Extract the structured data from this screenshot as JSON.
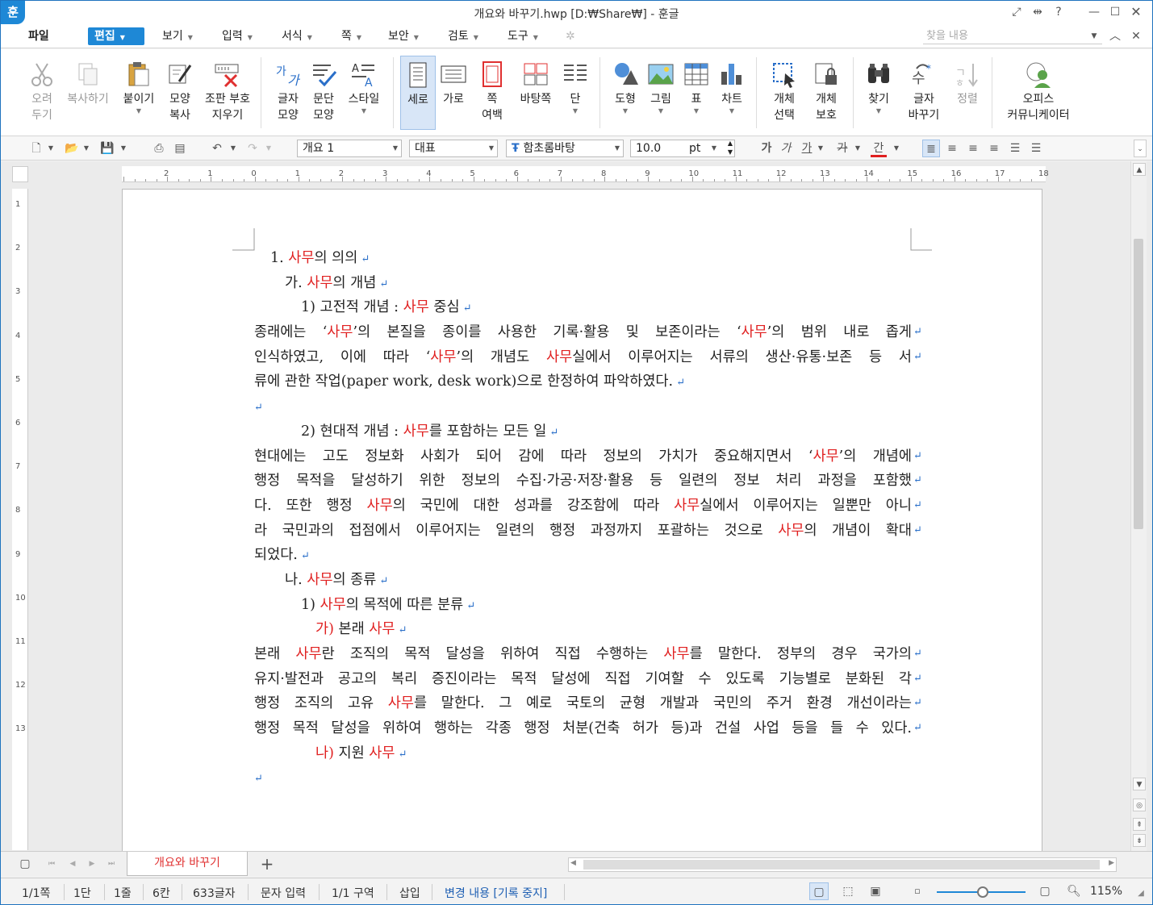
{
  "window": {
    "title": "개요와 바꾸기.hwp [D:₩Share₩] - 훈글",
    "logo": "훈"
  },
  "menus": [
    {
      "label": "파일"
    },
    {
      "label": "편집"
    },
    {
      "label": "보기"
    },
    {
      "label": "입력"
    },
    {
      "label": "서식"
    },
    {
      "label": "쪽"
    },
    {
      "label": "보안"
    },
    {
      "label": "검토"
    },
    {
      "label": "도구"
    }
  ],
  "find": {
    "placeholder": "찾을 내용"
  },
  "ribbon": {
    "cut": [
      "오려",
      "두기"
    ],
    "copy": "복사하기",
    "paste": "붙이기",
    "format_copy": [
      "모양",
      "복사"
    ],
    "clear_marks": [
      "조판 부호",
      "지우기"
    ],
    "char_shape": [
      "글자",
      "모양"
    ],
    "para_shape": [
      "문단",
      "모양"
    ],
    "style": "스타일",
    "vertical": "세로",
    "horizontal": "가로",
    "page_margin": [
      "쪽",
      "여백"
    ],
    "master_page": "바탕쪽",
    "columns": "단",
    "shape": "도형",
    "picture": "그림",
    "table": "표",
    "chart": "차트",
    "obj_select": [
      "개체",
      "선택"
    ],
    "obj_protect": [
      "개체",
      "보호"
    ],
    "find": "찾기",
    "replace": [
      "글자",
      "바꾸기"
    ],
    "sort": "정렬",
    "office": [
      "오피스",
      "커뮤니케이터"
    ]
  },
  "format": {
    "style": "개요 1",
    "lang": "대표",
    "font": "함초롬바탕",
    "size": "10.0",
    "unit": "pt"
  },
  "document": {
    "lines": [
      {
        "indent": 20,
        "parts": [
          [
            "1. ",
            0
          ],
          [
            "사무",
            1
          ],
          [
            "의 의의",
            0
          ]
        ]
      },
      {
        "indent": 38,
        "parts": [
          [
            "가. ",
            0
          ],
          [
            "사무",
            1
          ],
          [
            "의 개념",
            0
          ]
        ]
      },
      {
        "indent": 58,
        "parts": [
          [
            "1) 고전적 개념 : ",
            0
          ],
          [
            "사무",
            1
          ],
          [
            " 중심",
            0
          ]
        ]
      },
      {
        "indent": 0,
        "just": true,
        "parts": [
          [
            "종래에는 ‘",
            0
          ],
          [
            "사무",
            1
          ],
          [
            "’의 본질을 종이를 사용한 기록·활용 및 보존이라는 ‘",
            0
          ],
          [
            "사무",
            1
          ],
          [
            "’의 범위 내로 좁게",
            0
          ]
        ]
      },
      {
        "indent": 0,
        "just": true,
        "parts": [
          [
            "인식하였고, 이에 따라 ‘",
            0
          ],
          [
            "사무",
            1
          ],
          [
            "’의 개념도 ",
            0
          ],
          [
            "사무",
            1
          ],
          [
            "실에서 이루어지는 서류의 생산·유통·보존 등 서",
            0
          ]
        ]
      },
      {
        "indent": 0,
        "parts": [
          [
            "류에 관한 작업(paper work, desk work)으로 한정하여 파악하였다.",
            0
          ]
        ]
      },
      {
        "indent": 0,
        "parts": []
      },
      {
        "indent": 58,
        "parts": [
          [
            "2) 현대적 개념 : ",
            0
          ],
          [
            "사무",
            1
          ],
          [
            "를 포함하는 모든 일",
            0
          ]
        ]
      },
      {
        "indent": 0,
        "just": true,
        "parts": [
          [
            "현대에는 고도 정보화 사회가 되어 감에 따라 정보의 가치가 중요해지면서 ‘",
            0
          ],
          [
            "사무",
            1
          ],
          [
            "’의 개념에",
            0
          ]
        ]
      },
      {
        "indent": 0,
        "just": true,
        "parts": [
          [
            "행정 목적을 달성하기 위한 정보의 수집·가공·저장·활용 등 일련의 정보 처리 과정을 포함했",
            0
          ]
        ]
      },
      {
        "indent": 0,
        "just": true,
        "parts": [
          [
            "다. 또한 행정 ",
            0
          ],
          [
            "사무",
            1
          ],
          [
            "의 국민에 대한 성과를 강조함에 따라 ",
            0
          ],
          [
            "사무",
            1
          ],
          [
            "실에서 이루어지는 일뿐만 아니",
            0
          ]
        ]
      },
      {
        "indent": 0,
        "just": true,
        "parts": [
          [
            "라 국민과의 접점에서 이루어지는 일련의 행정 과정까지 포괄하는 것으로 ",
            0
          ],
          [
            "사무",
            1
          ],
          [
            "의 개념이 확대",
            0
          ]
        ]
      },
      {
        "indent": 0,
        "parts": [
          [
            "되었다.",
            0
          ]
        ]
      },
      {
        "indent": 38,
        "parts": [
          [
            "나. ",
            0
          ],
          [
            "사무",
            1
          ],
          [
            "의 종류",
            0
          ]
        ]
      },
      {
        "indent": 58,
        "parts": [
          [
            "1) ",
            0
          ],
          [
            "사무",
            1
          ],
          [
            "의 목적에 따른 분류",
            0
          ]
        ]
      },
      {
        "indent": 76,
        "parts": [
          [
            "가) ",
            1
          ],
          [
            "본래 ",
            0
          ],
          [
            "사무",
            1
          ]
        ]
      },
      {
        "indent": 0,
        "just": true,
        "parts": [
          [
            "본래 ",
            0
          ],
          [
            "사무",
            1
          ],
          [
            "란 조직의 목적 달성을 위하여 직접 수행하는 ",
            0
          ],
          [
            "사무",
            1
          ],
          [
            "를 말한다. 정부의 경우 국가의",
            0
          ]
        ]
      },
      {
        "indent": 0,
        "just": true,
        "parts": [
          [
            "유지·발전과 공고의 복리 증진이라는 목적 달성에 직접 기여할 수 있도록 기능별로 분화된 각",
            0
          ]
        ]
      },
      {
        "indent": 0,
        "just": true,
        "parts": [
          [
            "행정 조직의 고유 ",
            0
          ],
          [
            "사무",
            1
          ],
          [
            "를 말한다. 그 예로 국토의 균형 개발과 국민의 주거 환경 개선이라는",
            0
          ]
        ]
      },
      {
        "indent": 0,
        "just": true,
        "parts": [
          [
            "행정 목적 달성을 위하여 행하는 각종 행정 처분(건축 허가 등)과 건설 사업 등을 들 수 있다.",
            0
          ]
        ]
      },
      {
        "indent": 76,
        "parts": [
          [
            "나) ",
            1
          ],
          [
            "지원 ",
            0
          ],
          [
            "사무",
            1
          ]
        ]
      },
      {
        "indent": 0,
        "parts": []
      }
    ]
  },
  "ruler": {
    "h": [
      "2",
      "1",
      "0",
      "1",
      "2",
      "3",
      "4",
      "5",
      "6",
      "7",
      "8",
      "9",
      "10",
      "11",
      "12",
      "13",
      "14",
      "15",
      "16",
      "17",
      "18"
    ],
    "v": [
      "1",
      "2",
      "3",
      "4",
      "5",
      "6",
      "7",
      "8",
      "9",
      "10",
      "11",
      "12",
      "13"
    ]
  },
  "tab": {
    "name": "개요와 바꾸기",
    "add": "+"
  },
  "status": {
    "page": "1/1쪽",
    "col": "1단",
    "line": "1줄",
    "pos": "6칸",
    "chars": "633글자",
    "input": "문자 입력",
    "section": "1/1 구역",
    "insert": "삽입",
    "track": "변경 내용 [기록 중지]",
    "zoom": "115%"
  },
  "colors": {
    "accent": "#1e88d6",
    "highlight": "#e02020",
    "para_mark": "#2a6fc9"
  }
}
